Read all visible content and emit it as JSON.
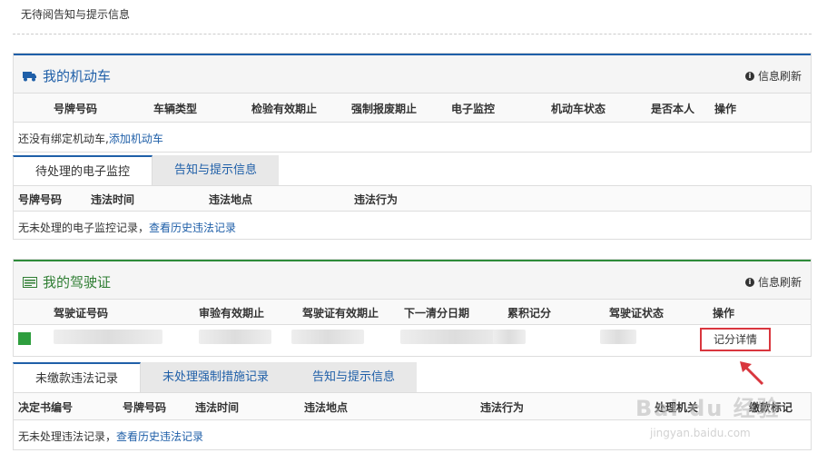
{
  "top_note": "无待阅告知与提示信息",
  "vehicle": {
    "title": "我的机动车",
    "refresh": "信息刷新",
    "headers": [
      "号牌号码",
      "车辆类型",
      "检验有效期止",
      "强制报废期止",
      "电子监控",
      "机动车状态",
      "是否本人",
      "操作"
    ],
    "empty_text": "还没有绑定机动车,",
    "add_link": "添加机动车",
    "tabs": [
      "待处理的电子监控",
      "告知与提示信息"
    ],
    "tab_headers": [
      "号牌号码",
      "违法时间",
      "违法地点",
      "违法行为"
    ],
    "tab_empty": "无未处理的电子监控记录，",
    "tab_history": "查看历史违法记录"
  },
  "license": {
    "title": "我的驾驶证",
    "refresh": "信息刷新",
    "headers": [
      "驾驶证号码",
      "审验有效期止",
      "驾驶证有效期止",
      "下一清分日期",
      "累积记分",
      "驾驶证状态",
      "操作"
    ],
    "detail_button": "记分详情",
    "tabs": [
      "未缴款违法记录",
      "未处理强制措施记录",
      "告知与提示信息"
    ],
    "tab_headers": [
      "决定书编号",
      "号牌号码",
      "违法时间",
      "违法地点",
      "违法行为",
      "处理机关",
      "缴款标记"
    ],
    "tab_empty": "无未处理违法记录，",
    "tab_history": "查看历史违法记录"
  },
  "watermark": {
    "main": "Bai du 经验",
    "sub": "jingyan.baidu.com"
  },
  "colors": {
    "blue_accent": "#1f5fa8",
    "green_accent": "#2e8b3a",
    "highlight_red": "#d9363e"
  }
}
